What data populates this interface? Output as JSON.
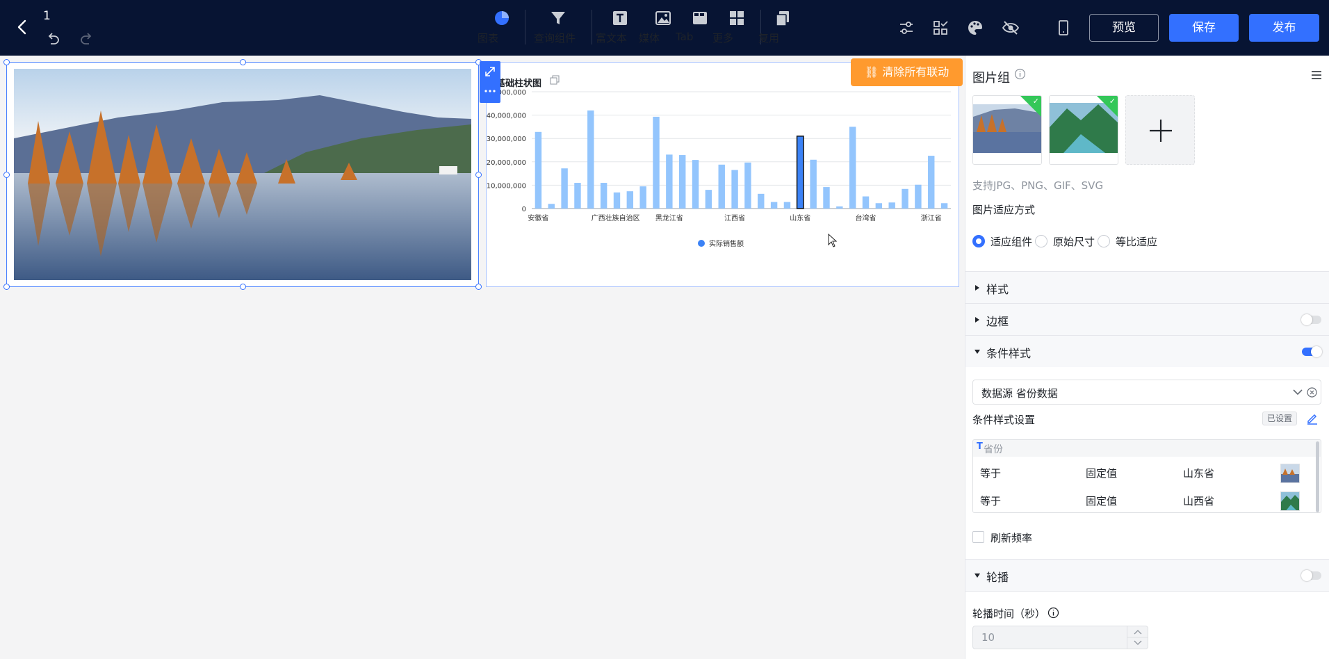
{
  "topbar": {
    "page_number": "1",
    "tools": [
      {
        "label": "图表",
        "icon": "pie-chart-icon"
      },
      {
        "label": "查询组件",
        "icon": "filter-icon"
      },
      {
        "label": "富文本",
        "icon": "text-icon"
      },
      {
        "label": "媒体",
        "icon": "image-icon"
      },
      {
        "label": "Tab",
        "icon": "tab-icon"
      },
      {
        "label": "更多",
        "icon": "grid-icon"
      },
      {
        "label": "复用",
        "icon": "copy-icon"
      }
    ],
    "preview_label": "预览",
    "save_label": "保存",
    "publish_label": "发布"
  },
  "canvas": {
    "clear_linkage_label": "清除所有联动"
  },
  "chart_data": {
    "type": "bar",
    "title": "基础柱状图",
    "ylim": [
      0,
      50000000
    ],
    "y_ticks": [
      "0",
      "10,000,000",
      "20,000,000",
      "30,000,000",
      "40,000,000",
      "50,000,000"
    ],
    "x_tick_labels": [
      "安徽省",
      "广西壮族自治区",
      "黑龙江省",
      "江西省",
      "山东省",
      "台湾省",
      "浙江省"
    ],
    "legend": "实际销售额",
    "series": [
      {
        "name": "实际销售额",
        "values": [
          32800000,
          2000000,
          17200000,
          11000000,
          42000000,
          11000000,
          6900000,
          7400000,
          9500000,
          39300000,
          23100000,
          22900000,
          20800000,
          8000000,
          18800000,
          16500000,
          19700000,
          6300000,
          2800000,
          2800000,
          31000000,
          20900000,
          9200000,
          900000,
          35000000,
          5200000,
          2300000,
          2600000,
          8400000,
          10200000,
          22600000,
          2300000
        ]
      }
    ],
    "highlight_index": 20,
    "bar_color": "#93c5fd",
    "highlight_color": "#3b82f6",
    "grid": true,
    "legend_position": "bottom"
  },
  "panel": {
    "title": "图片组",
    "hint": "支持JPG、PNG、GIF、SVG",
    "fit_mode_label": "图片适应方式",
    "fit_options": [
      "适应组件",
      "原始尺寸",
      "等比适应"
    ],
    "fit_selected": "适应组件",
    "sections": {
      "style": "样式",
      "border": "边框",
      "conditional": "条件样式",
      "carousel": "轮播"
    },
    "datasource_label": "数据源 省份数据",
    "cond_setting_label": "条件样式设置",
    "cond_status": "已设置",
    "cond_field": "省份",
    "cond_rows": [
      {
        "op": "等于",
        "type": "固定值",
        "value": "山东省"
      },
      {
        "op": "等于",
        "type": "固定值",
        "value": "山西省"
      }
    ],
    "refresh_label": "刷新频率",
    "carousel_time_label": "轮播时间（秒）",
    "carousel_time_value": "10"
  },
  "colors": {
    "accent": "#3370ff",
    "topbar_bg": "#071433",
    "warning": "#ff9a2e",
    "check_green": "#34c759"
  }
}
